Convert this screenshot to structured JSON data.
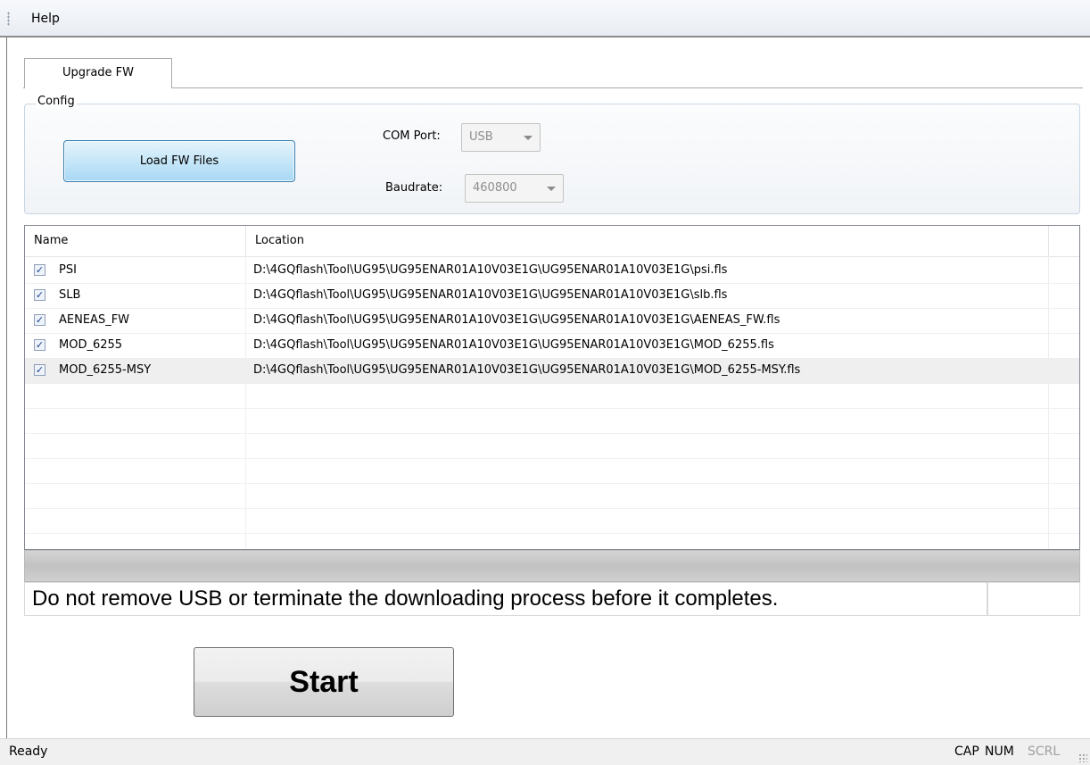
{
  "menu": {
    "help": "Help"
  },
  "tab": {
    "label": "Upgrade FW"
  },
  "config": {
    "title": "Config",
    "load_button": "Load FW Files",
    "com_port_label": "COM Port:",
    "com_port_value": "USB",
    "baudrate_label": "Baudrate:",
    "baudrate_value": "460800"
  },
  "list": {
    "columns": [
      "Name",
      "Location"
    ],
    "rows": [
      {
        "checked": true,
        "name": "PSI",
        "location": "D:\\4GQflash\\Tool\\UG95\\UG95ENAR01A10V03E1G\\UG95ENAR01A10V03E1G\\psi.fls"
      },
      {
        "checked": true,
        "name": "SLB",
        "location": "D:\\4GQflash\\Tool\\UG95\\UG95ENAR01A10V03E1G\\UG95ENAR01A10V03E1G\\slb.fls"
      },
      {
        "checked": true,
        "name": "AENEAS_FW",
        "location": "D:\\4GQflash\\Tool\\UG95\\UG95ENAR01A10V03E1G\\UG95ENAR01A10V03E1G\\AENEAS_FW.fls"
      },
      {
        "checked": true,
        "name": "MOD_6255",
        "location": "D:\\4GQflash\\Tool\\UG95\\UG95ENAR01A10V03E1G\\UG95ENAR01A10V03E1G\\MOD_6255.fls"
      },
      {
        "checked": true,
        "name": "MOD_6255-MSY",
        "location": "D:\\4GQflash\\Tool\\UG95\\UG95ENAR01A10V03E1G\\UG95ENAR01A10V03E1G\\MOD_6255-MSY.fls"
      }
    ],
    "selected_row": 4
  },
  "progress": {
    "fraction": 0
  },
  "message": "Do not remove USB or terminate the downloading process before it completes.",
  "start_button": "Start",
  "status": {
    "text": "Ready",
    "indicators": [
      {
        "label": "CAP",
        "active": true
      },
      {
        "label": "NUM",
        "active": true
      },
      {
        "label": "SCRL",
        "active": false
      }
    ]
  },
  "colors": {
    "progress_fill": "#06b025",
    "button_accent": "#3c7fb1"
  }
}
